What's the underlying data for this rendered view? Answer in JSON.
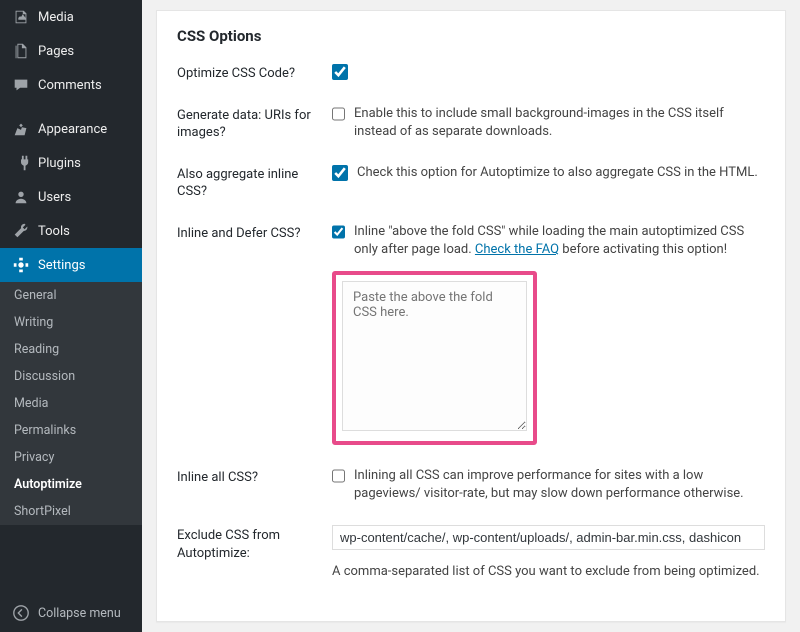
{
  "sidebar": {
    "items": [
      {
        "label": "Media",
        "icon": "media"
      },
      {
        "label": "Pages",
        "icon": "pages"
      },
      {
        "label": "Comments",
        "icon": "comments"
      },
      {
        "label": "Appearance",
        "icon": "appearance"
      },
      {
        "label": "Plugins",
        "icon": "plugins"
      },
      {
        "label": "Users",
        "icon": "users"
      },
      {
        "label": "Tools",
        "icon": "tools"
      },
      {
        "label": "Settings",
        "icon": "settings",
        "active": true
      }
    ],
    "sub": [
      "General",
      "Writing",
      "Reading",
      "Discussion",
      "Media",
      "Permalinks",
      "Privacy",
      "Autoptimize",
      "ShortPixel"
    ],
    "collapse": "Collapse menu"
  },
  "panel": {
    "title": "CSS Options",
    "rows": {
      "optimize": {
        "label": "Optimize CSS Code?"
      },
      "datauri": {
        "label": "Generate data: URIs for images?",
        "desc": "Enable this to include small background-images in the CSS itself instead of as separate downloads."
      },
      "aggregate": {
        "label": "Also aggregate inline CSS?",
        "desc": "Check this option for Autoptimize to also aggregate CSS in the HTML."
      },
      "inlinedefer": {
        "label": "Inline and Defer CSS?",
        "desc_pre": "Inline \"above the fold CSS\" while loading the main autoptimized CSS only after page load. ",
        "link": "Check the FAQ",
        "desc_post": " before activating this option!",
        "placeholder": "Paste the above the fold CSS here."
      },
      "inlineall": {
        "label": "Inline all CSS?",
        "desc": "Inlining all CSS can improve performance for sites with a low pageviews/ visitor-rate, but may slow down performance otherwise."
      },
      "exclude": {
        "label": "Exclude CSS from Autoptimize:",
        "value": "wp-content/cache/, wp-content/uploads/, admin-bar.min.css, dashicon",
        "desc": "A comma-separated list of CSS you want to exclude from being optimized."
      }
    }
  }
}
